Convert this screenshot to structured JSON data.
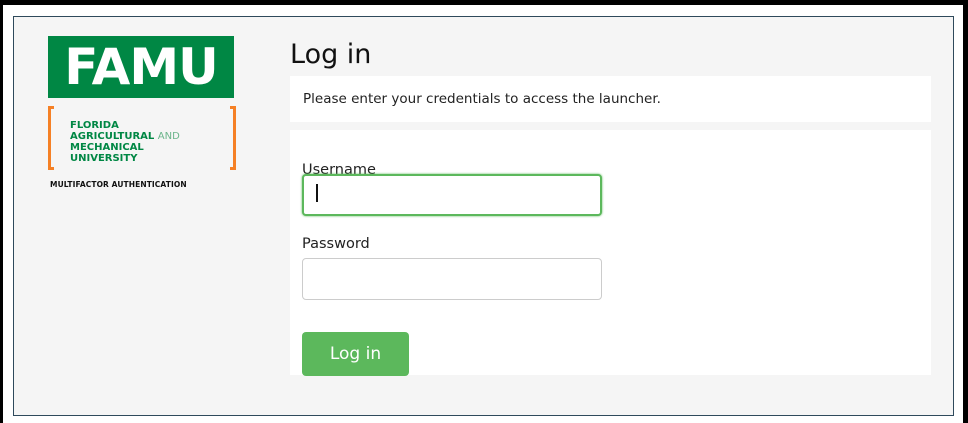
{
  "logo": {
    "wordmark": "FAMU",
    "line1": "FLORIDA",
    "line2_bold": "AGRICULTURAL",
    "line2_light": "AND",
    "line3": "MECHANICAL",
    "line4": "UNIVERSITY",
    "tagline": "MULTIFACTOR AUTHENTICATION"
  },
  "page": {
    "title": "Log in",
    "message": "Please enter your credentials to access the launcher."
  },
  "form": {
    "username_label": "Username",
    "username_value": "",
    "password_label": "Password",
    "password_value": "",
    "submit_label": "Log in"
  },
  "colors": {
    "brand_green": "#008744",
    "brand_orange": "#f58025",
    "button_green": "#5cb85c"
  }
}
